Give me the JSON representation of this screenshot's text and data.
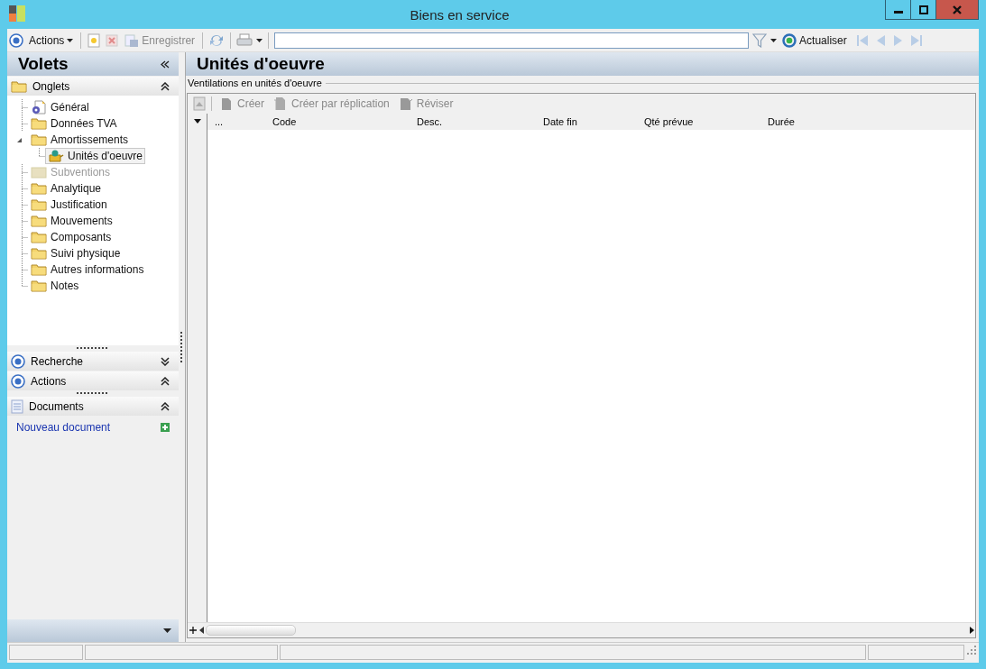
{
  "window": {
    "title": "Biens en service"
  },
  "toolbar": {
    "actions_menu": "Actions",
    "save": {
      "label": "Enregistrer",
      "disabled": true
    },
    "refresh": "Actualiser"
  },
  "sidebar": {
    "title": "Volets",
    "tabs_section": {
      "title": "Onglets",
      "expanded": true
    },
    "tree": [
      {
        "kind": "page",
        "label": "Général",
        "disabled": false,
        "selected": false
      },
      {
        "kind": "folder",
        "label": "Données TVA",
        "disabled": false,
        "selected": false
      },
      {
        "kind": "folder",
        "label": "Amortissements",
        "disabled": false,
        "selected": false,
        "expanded": true,
        "children": [
          {
            "kind": "pot",
            "label": "Unités d'oeuvre",
            "disabled": false,
            "selected": true
          }
        ]
      },
      {
        "kind": "folder",
        "label": "Subventions",
        "disabled": true,
        "selected": false
      },
      {
        "kind": "folder",
        "label": "Analytique",
        "disabled": false,
        "selected": false
      },
      {
        "kind": "folder",
        "label": "Justification",
        "disabled": false,
        "selected": false
      },
      {
        "kind": "folder",
        "label": "Mouvements",
        "disabled": false,
        "selected": false
      },
      {
        "kind": "folder",
        "label": "Composants",
        "disabled": false,
        "selected": false
      },
      {
        "kind": "folder",
        "label": "Suivi physique",
        "disabled": false,
        "selected": false
      },
      {
        "kind": "folder",
        "label": "Autres informations",
        "disabled": false,
        "selected": false
      },
      {
        "kind": "folder",
        "label": "Notes",
        "disabled": false,
        "selected": false
      }
    ],
    "sections": [
      {
        "title": "Recherche",
        "expanded": false
      },
      {
        "title": "Actions",
        "expanded": true
      }
    ],
    "documents": {
      "title": "Documents",
      "expanded": true,
      "link": "Nouveau document"
    }
  },
  "main": {
    "title": "Unités d'oeuvre",
    "group_label": "Ventilations en unités d'oeuvre",
    "grid_toolbar": [
      {
        "label": "Créer",
        "disabled": true
      },
      {
        "label": "Créer par réplication",
        "disabled": true
      },
      {
        "label": "Réviser",
        "disabled": true
      }
    ],
    "columns": [
      "...",
      "Code",
      "Desc.",
      "Date fin",
      "Qté prévue",
      "Durée"
    ]
  }
}
